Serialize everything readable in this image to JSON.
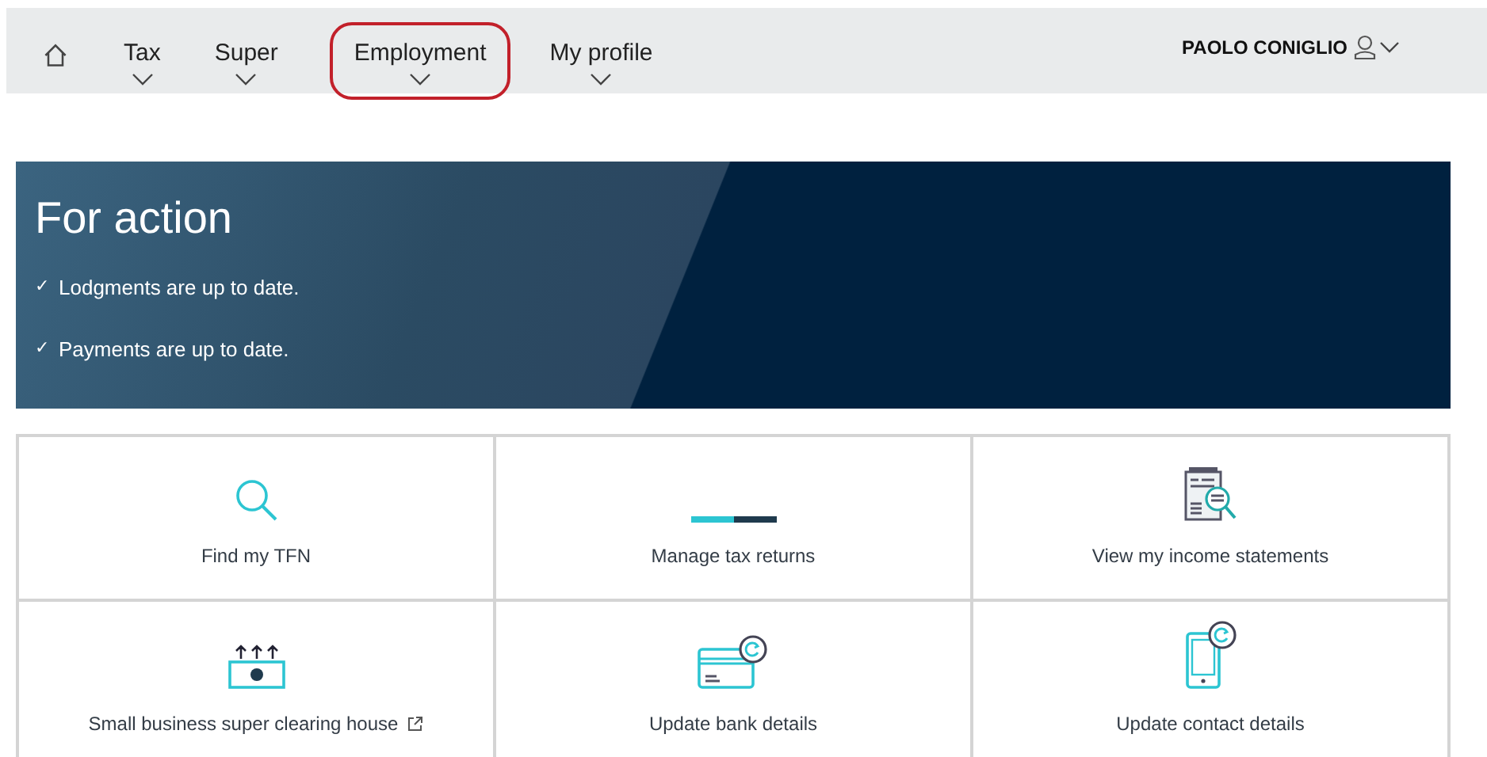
{
  "nav": {
    "items": [
      {
        "label": "Tax",
        "highlighted": false
      },
      {
        "label": "Super",
        "highlighted": false
      },
      {
        "label": "Employment",
        "highlighted": true
      },
      {
        "label": "My profile",
        "highlighted": false
      }
    ],
    "user": "PAOLO CONIGLIO"
  },
  "banner": {
    "title": "For action",
    "items": [
      "Lodgments are up to date.",
      "Payments are up to date."
    ],
    "tick": "✓"
  },
  "tiles": [
    {
      "kind": "search",
      "label": "Find my TFN",
      "external": false
    },
    {
      "kind": "progress",
      "label": "Manage tax returns",
      "external": false
    },
    {
      "kind": "statement",
      "label": "View my income statements",
      "external": false
    },
    {
      "kind": "money",
      "label": "Small business super clearing house",
      "external": true
    },
    {
      "kind": "card",
      "label": "Update bank details",
      "external": false
    },
    {
      "kind": "phone",
      "label": "Update contact details",
      "external": false
    }
  ]
}
